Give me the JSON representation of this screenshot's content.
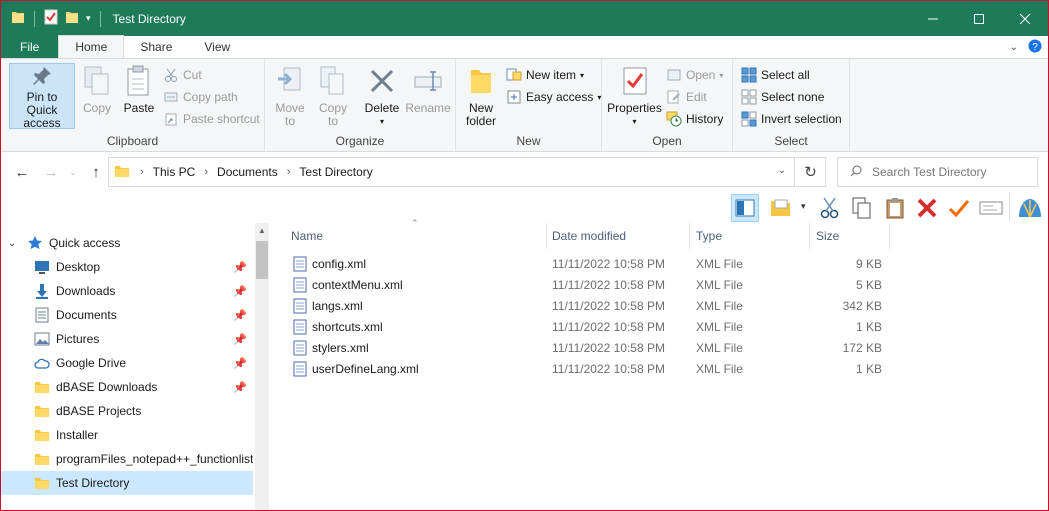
{
  "window": {
    "title": "Test Directory"
  },
  "ribbon_tabs": [
    "File",
    "Home",
    "Share",
    "View"
  ],
  "ribbon": {
    "clipboard": {
      "label": "Clipboard",
      "pin_label_1": "Pin to Quick",
      "pin_label_2": "access",
      "copy": "Copy",
      "paste": "Paste",
      "cut": "Cut",
      "copy_path": "Copy path",
      "paste_shortcut": "Paste shortcut"
    },
    "organize": {
      "label": "Organize",
      "move_to_1": "Move",
      "move_to_2": "to",
      "copy_to_1": "Copy",
      "copy_to_2": "to",
      "delete": "Delete",
      "rename": "Rename"
    },
    "new": {
      "label": "New",
      "new_folder_1": "New",
      "new_folder_2": "folder",
      "new_item": "New item",
      "easy_access": "Easy access"
    },
    "open": {
      "label": "Open",
      "properties": "Properties",
      "open": "Open",
      "edit": "Edit",
      "history": "History"
    },
    "select": {
      "label": "Select",
      "select_all": "Select all",
      "select_none": "Select none",
      "invert_selection": "Invert selection"
    }
  },
  "address": {
    "crumbs": [
      "This PC",
      "Documents",
      "Test Directory"
    ],
    "search_placeholder": "Search Test Directory"
  },
  "nav_pane": {
    "quick_access": "Quick access",
    "items": [
      {
        "label": "Desktop",
        "icon": "desktop-icon",
        "pinned": true
      },
      {
        "label": "Downloads",
        "icon": "downloads-icon",
        "pinned": true
      },
      {
        "label": "Documents",
        "icon": "documents-icon",
        "pinned": true
      },
      {
        "label": "Pictures",
        "icon": "pictures-icon",
        "pinned": true
      },
      {
        "label": "Google Drive",
        "icon": "cloud-icon",
        "pinned": true
      },
      {
        "label": "dBASE Downloads",
        "icon": "folder-icon",
        "pinned": true
      },
      {
        "label": "dBASE Projects",
        "icon": "folder-icon",
        "pinned": false
      },
      {
        "label": "Installer",
        "icon": "folder-icon",
        "pinned": false
      },
      {
        "label": "programFiles_notepad++_functionlist",
        "icon": "folder-icon",
        "pinned": false
      },
      {
        "label": "Test Directory",
        "icon": "folder-icon",
        "pinned": false,
        "selected": true
      }
    ]
  },
  "file_list": {
    "columns": [
      "Name",
      "Date modified",
      "Type",
      "Size"
    ],
    "rows": [
      {
        "name": "config.xml",
        "date": "11/11/2022 10:58 PM",
        "type": "XML File",
        "size": "9 KB"
      },
      {
        "name": "contextMenu.xml",
        "date": "11/11/2022 10:58 PM",
        "type": "XML File",
        "size": "5 KB"
      },
      {
        "name": "langs.xml",
        "date": "11/11/2022 10:58 PM",
        "type": "XML File",
        "size": "342 KB"
      },
      {
        "name": "shortcuts.xml",
        "date": "11/11/2022 10:58 PM",
        "type": "XML File",
        "size": "1 KB"
      },
      {
        "name": "stylers.xml",
        "date": "11/11/2022 10:58 PM",
        "type": "XML File",
        "size": "172 KB"
      },
      {
        "name": "userDefineLang.xml",
        "date": "11/11/2022 10:58 PM",
        "type": "XML File",
        "size": "1 KB"
      }
    ]
  },
  "colors": {
    "titlebar": "#1e7b5a",
    "selection": "#cce8ff",
    "window_border": "#c8102e"
  }
}
